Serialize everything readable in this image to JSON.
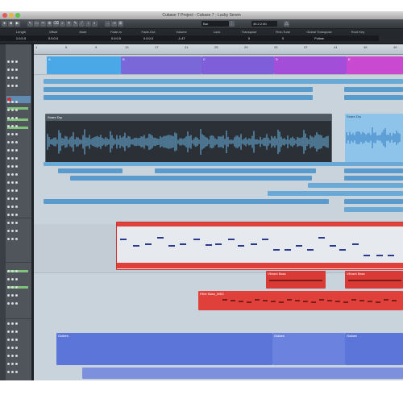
{
  "window": {
    "title": "Cubase 7 Project - Cubase 7 - Lucky Seven"
  },
  "toolbar": {
    "project_field": "Bar",
    "position_display": "45.2.2.80"
  },
  "info_line": {
    "headers": [
      "Length",
      "Offset",
      "Mute",
      "Fade-In",
      "Fade-Out",
      "Volume",
      "Lock",
      "Transpose",
      "Fine-Tune",
      "Global Transpose",
      "Root Key"
    ],
    "values": [
      "1.0.0.0",
      "0.0.0.0",
      "",
      "0.0.0.0",
      "0.0.0.0",
      "-1.47",
      "",
      "0",
      "0",
      "Follow",
      ""
    ]
  },
  "ruler": {
    "bars": [
      "1",
      "5",
      "9",
      "13",
      "17",
      "21",
      "25",
      "29",
      "33",
      "37",
      "41",
      "45",
      "49"
    ]
  },
  "parts": {
    "markers": [
      {
        "label": "A",
        "color": "#4aa8e6"
      },
      {
        "label": "B",
        "color": "#7b68d8"
      },
      {
        "label": "C",
        "color": "#7f5fd9"
      },
      {
        "label": "D",
        "color": "#a24ed8"
      },
      {
        "label": "E",
        "color": "#c94ad0"
      }
    ],
    "snare_label": "Snare Dry",
    "snare_label_2": "Snare Dry",
    "synth_label": "Vibrant Bass",
    "synth_label_2": "Vibrant Bass",
    "filter_label": "Filter Bass_MIDI",
    "guitar_label": "Guitars",
    "guitar_label_2": "Guitars",
    "guitar_label_3": "Guitars"
  },
  "colors": {
    "blue_part": "#4b95c9",
    "red_part": "#e0403a",
    "indigo_part": "#5b76d8",
    "accent": "#5f8cb0"
  }
}
